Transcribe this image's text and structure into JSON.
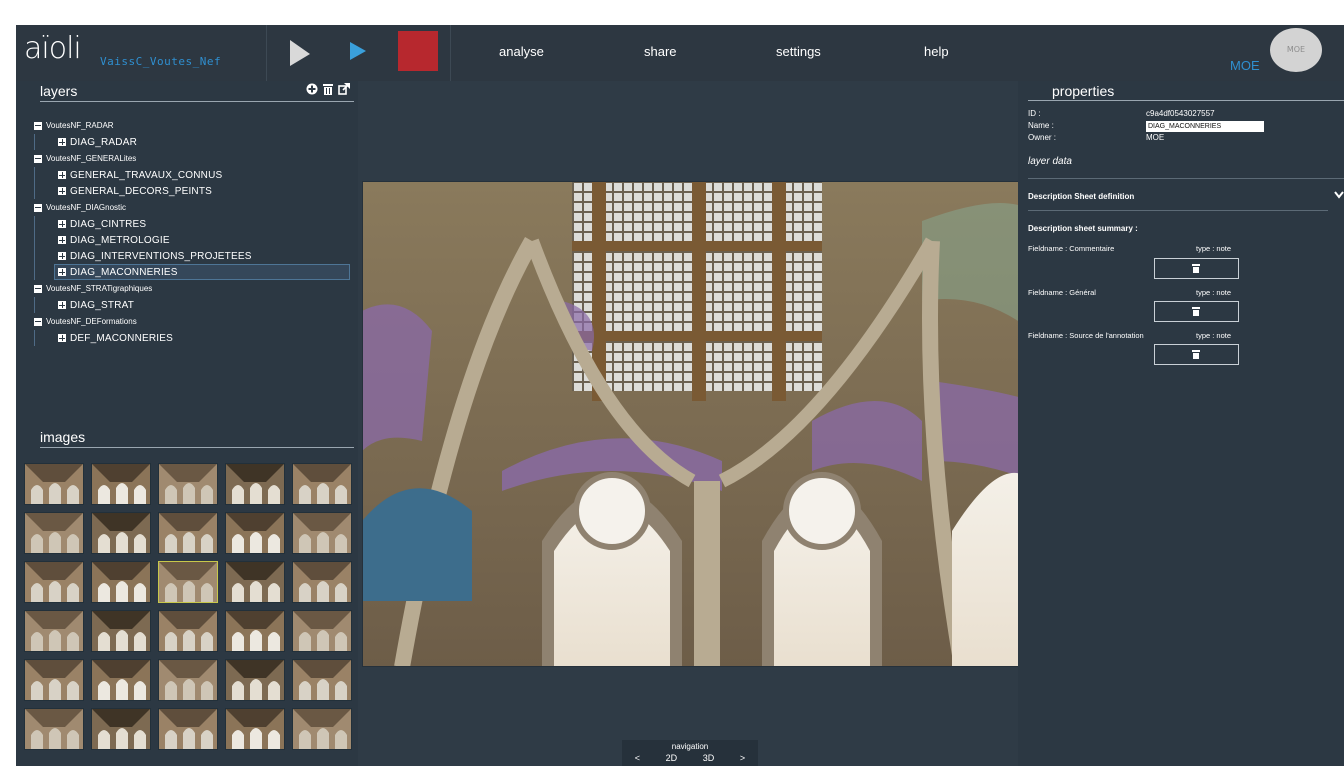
{
  "header": {
    "logo": "aïoli",
    "project_name": "VaissC_Voutes_Nef",
    "menu": [
      "analyse",
      "share",
      "settings",
      "help"
    ],
    "user_label": "MOE",
    "avatar_text": "MOE",
    "stop_color": "#b7282e",
    "play_color": "#3aa0dc"
  },
  "layers_panel": {
    "title": "layers",
    "tools": [
      "add-circle-icon",
      "trash-icon",
      "export-icon"
    ],
    "groups": [
      {
        "label": "VoutesNF_RADAR",
        "items": [
          "DIAG_RADAR"
        ]
      },
      {
        "label": "VoutesNF_GENERALites",
        "items": [
          "GENERAL_TRAVAUX_CONNUS",
          "GENERAL_DECORS_PEINTS"
        ]
      },
      {
        "label": "VoutesNF_DIAGnostic",
        "items": [
          "DIAG_CINTRES",
          "DIAG_METROLOGIE",
          "DIAG_INTERVENTIONS_PROJETEES",
          "DIAG_MACONNERIES"
        ]
      },
      {
        "label": "VoutesNF_STRATigraphiques",
        "items": [
          "DIAG_STRAT"
        ]
      },
      {
        "label": "VoutesNF_DEFormations",
        "items": [
          "DEF_MACONNERIES"
        ]
      }
    ],
    "selected_item": "DIAG_MACONNERIES"
  },
  "images_panel": {
    "title": "images",
    "thumbnail_count": 30,
    "selected_index": 12
  },
  "navigation": {
    "title": "navigation",
    "buttons": [
      "<",
      "2D",
      "3D",
      ">"
    ]
  },
  "properties": {
    "title": "properties",
    "id_label": "ID :",
    "id_value": "c9a4df0543027557",
    "name_label": "Name :",
    "name_value": "DIAG_MACONNERIES",
    "owner_label": "Owner :",
    "owner_value": "MOE",
    "layer_data": "layer data",
    "sheet_definition": "Description Sheet definition",
    "sheet_summary": "Description sheet summary :",
    "fields": [
      {
        "name": "Fieldname : Commentaire",
        "type": "type : note"
      },
      {
        "name": "Fieldname : Général",
        "type": "type : note"
      },
      {
        "name": "Fieldname : Source de l'annotation",
        "type": "type : note"
      }
    ]
  }
}
